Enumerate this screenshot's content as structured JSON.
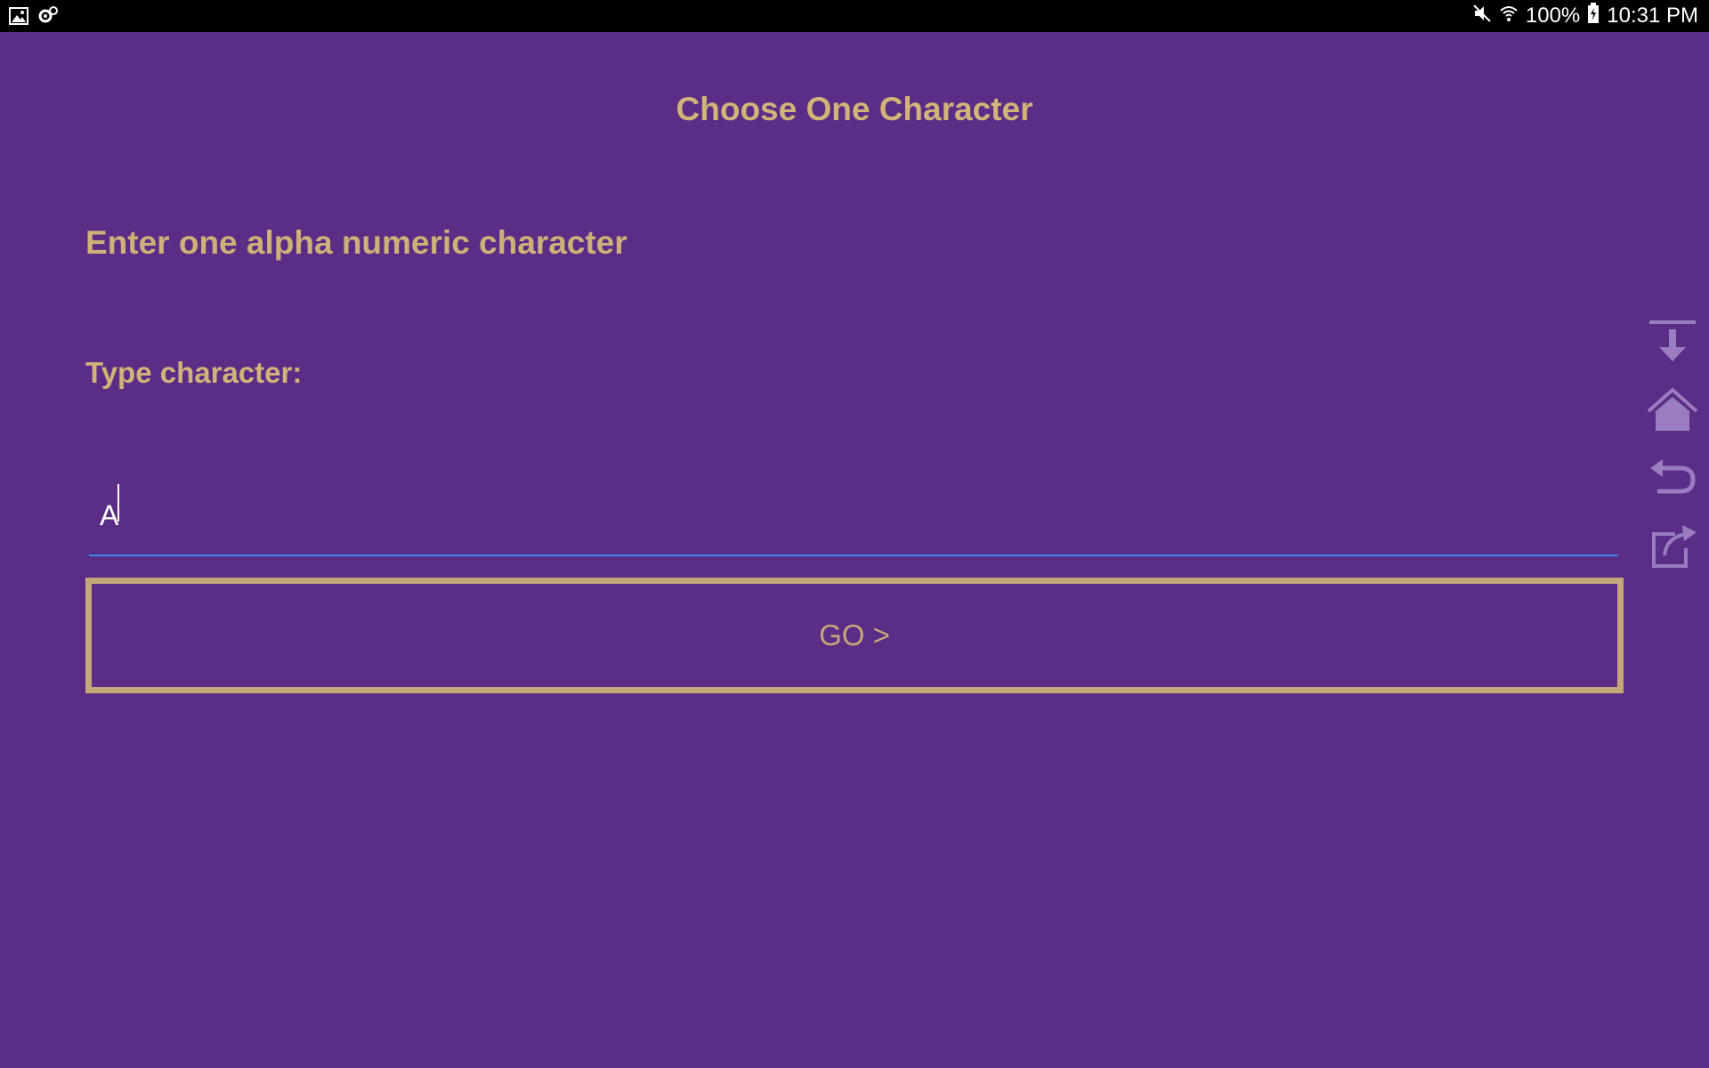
{
  "status_bar": {
    "battery": "100%",
    "time": "10:31 PM",
    "icons": [
      "gallery-icon",
      "settings-gear-icon",
      "mute-icon",
      "wifi-icon",
      "battery-charging-icon"
    ]
  },
  "app": {
    "title": "Choose One Character",
    "instruction": "Enter one alpha numeric character",
    "field_label": "Type character:",
    "input_value": "A",
    "go_button_label": "GO >"
  },
  "side_tools": [
    "download-icon",
    "home-icon",
    "back-icon",
    "share-icon"
  ],
  "colors": {
    "background": "#5a2d86",
    "text_accent": "#d1b479",
    "button_border": "#c4a878",
    "input_underline": "#3d86e8",
    "tool_icon": "#9a7cc0"
  }
}
